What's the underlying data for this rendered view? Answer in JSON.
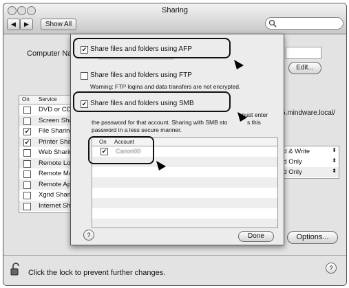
{
  "window": {
    "title": "Sharing"
  },
  "toolbar": {
    "back": "◀",
    "forward": "▶",
    "show_all": "Show All"
  },
  "search": {
    "icon": "magnifier-icon",
    "placeholder": ""
  },
  "main": {
    "computer_name_label": "Computer Na",
    "edit_button": "Edit...",
    "service_table": {
      "headers": {
        "on": "On",
        "service": "Service"
      },
      "rows": [
        {
          "checked": false,
          "label": "DVD or CD"
        },
        {
          "checked": false,
          "label": "Screen Sha"
        },
        {
          "checked": true,
          "label": "File Sharing"
        },
        {
          "checked": true,
          "label": "Printer Sha"
        },
        {
          "checked": false,
          "label": "Web Sharin"
        },
        {
          "checked": false,
          "label": "Remote Lo"
        },
        {
          "checked": false,
          "label": "Remote Ma"
        },
        {
          "checked": false,
          "label": "Remote Ap"
        },
        {
          "checked": false,
          "label": "Xgrid Shari"
        },
        {
          "checked": false,
          "label": "Internet Sh"
        }
      ]
    },
    "address_fragment": "5.mindware.local/",
    "permissions": [
      "ad & Write",
      "ad Only",
      "ad Only"
    ],
    "options_button": "Options...",
    "lock_text": "Click the lock to prevent further changes.",
    "help": "?"
  },
  "sheet": {
    "afp": {
      "checked": true,
      "label": "Share files and folders using AFP"
    },
    "ftp": {
      "checked": false,
      "label": "Share files and folders using FTP"
    },
    "ftp_warning": "Warning: FTP logins and data transfers are not encrypted.",
    "smb": {
      "checked": true,
      "label": "Share files and folders using SMB"
    },
    "smb_note_1": "must enter",
    "smb_note_2": "the password for that account. Sharing with SMB sto",
    "smb_note_2b": "s this",
    "smb_note_3": "password in a less secure manner.",
    "account_table": {
      "headers": {
        "on": "On",
        "account": "Account"
      },
      "rows": [
        {
          "checked": true,
          "account": "Canon00"
        }
      ]
    },
    "help": "?",
    "done_button": "Done"
  },
  "colors": {
    "window_bg": "#e3e3e3",
    "highlight_outline": "#111111"
  }
}
